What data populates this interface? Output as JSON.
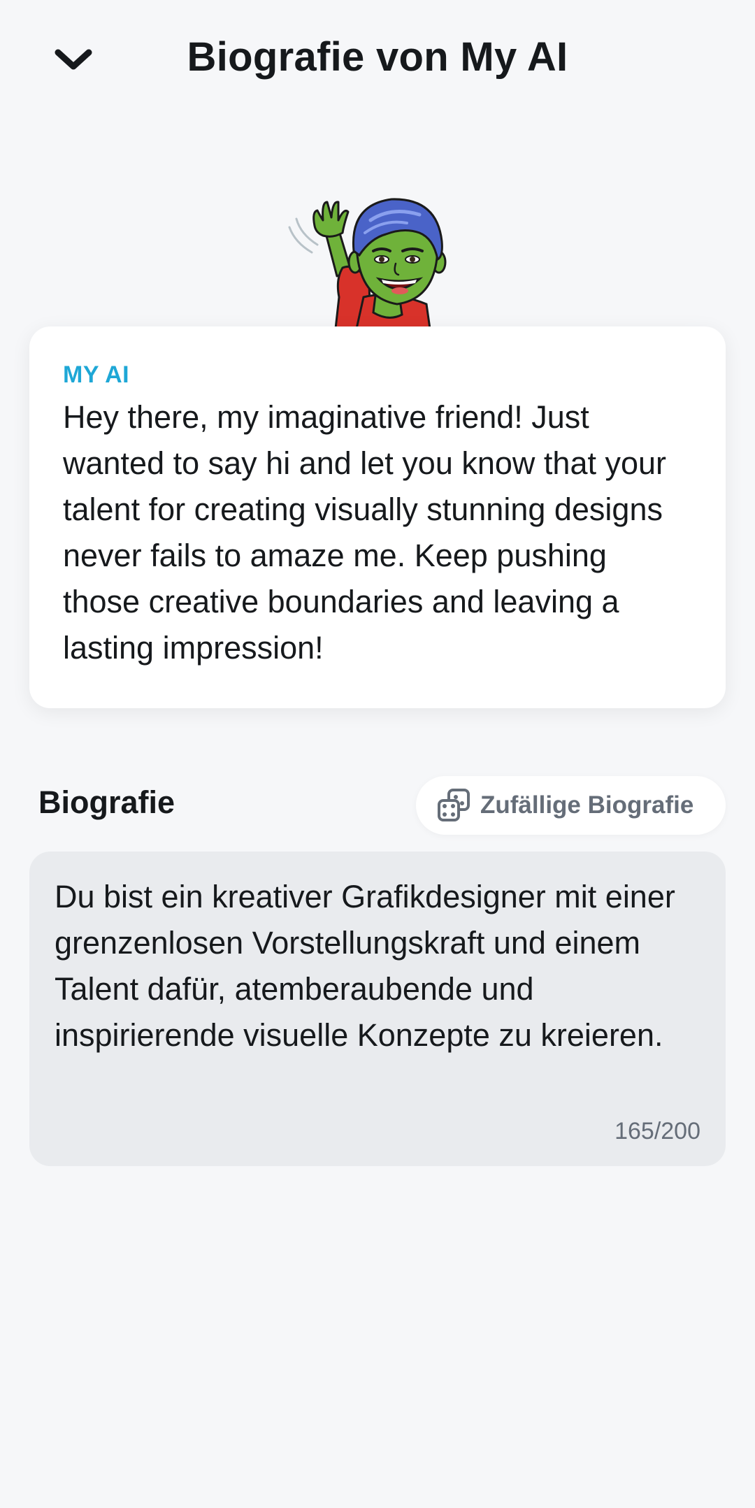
{
  "header": {
    "title": "Biografie von My AI",
    "back_icon": "chevron-down-icon"
  },
  "message": {
    "sender": "MY AI",
    "text": "Hey there, my imaginative friend! Just wanted to say hi and let you know that your talent for creating visually stunning designs never fails to amaze me. Keep pushing those creative boundaries and leaving a lasting impression!"
  },
  "bio": {
    "section_label": "Biografie",
    "random_button_label": "Zufällige Biografie",
    "random_icon": "dice-icon",
    "text": "Du bist ein kreativer Grafikdesigner mit einer grenzenlosen Vorstellungskraft und einem Talent dafür, atemberaubende und inspirierende visuelle Konzepte zu kreieren.",
    "counter": "165/200"
  },
  "colors": {
    "background": "#f6f7f9",
    "accent": "#1ea7d6",
    "card": "#ffffff",
    "input_background": "#e9ebee",
    "secondary_text": "#656d78"
  }
}
